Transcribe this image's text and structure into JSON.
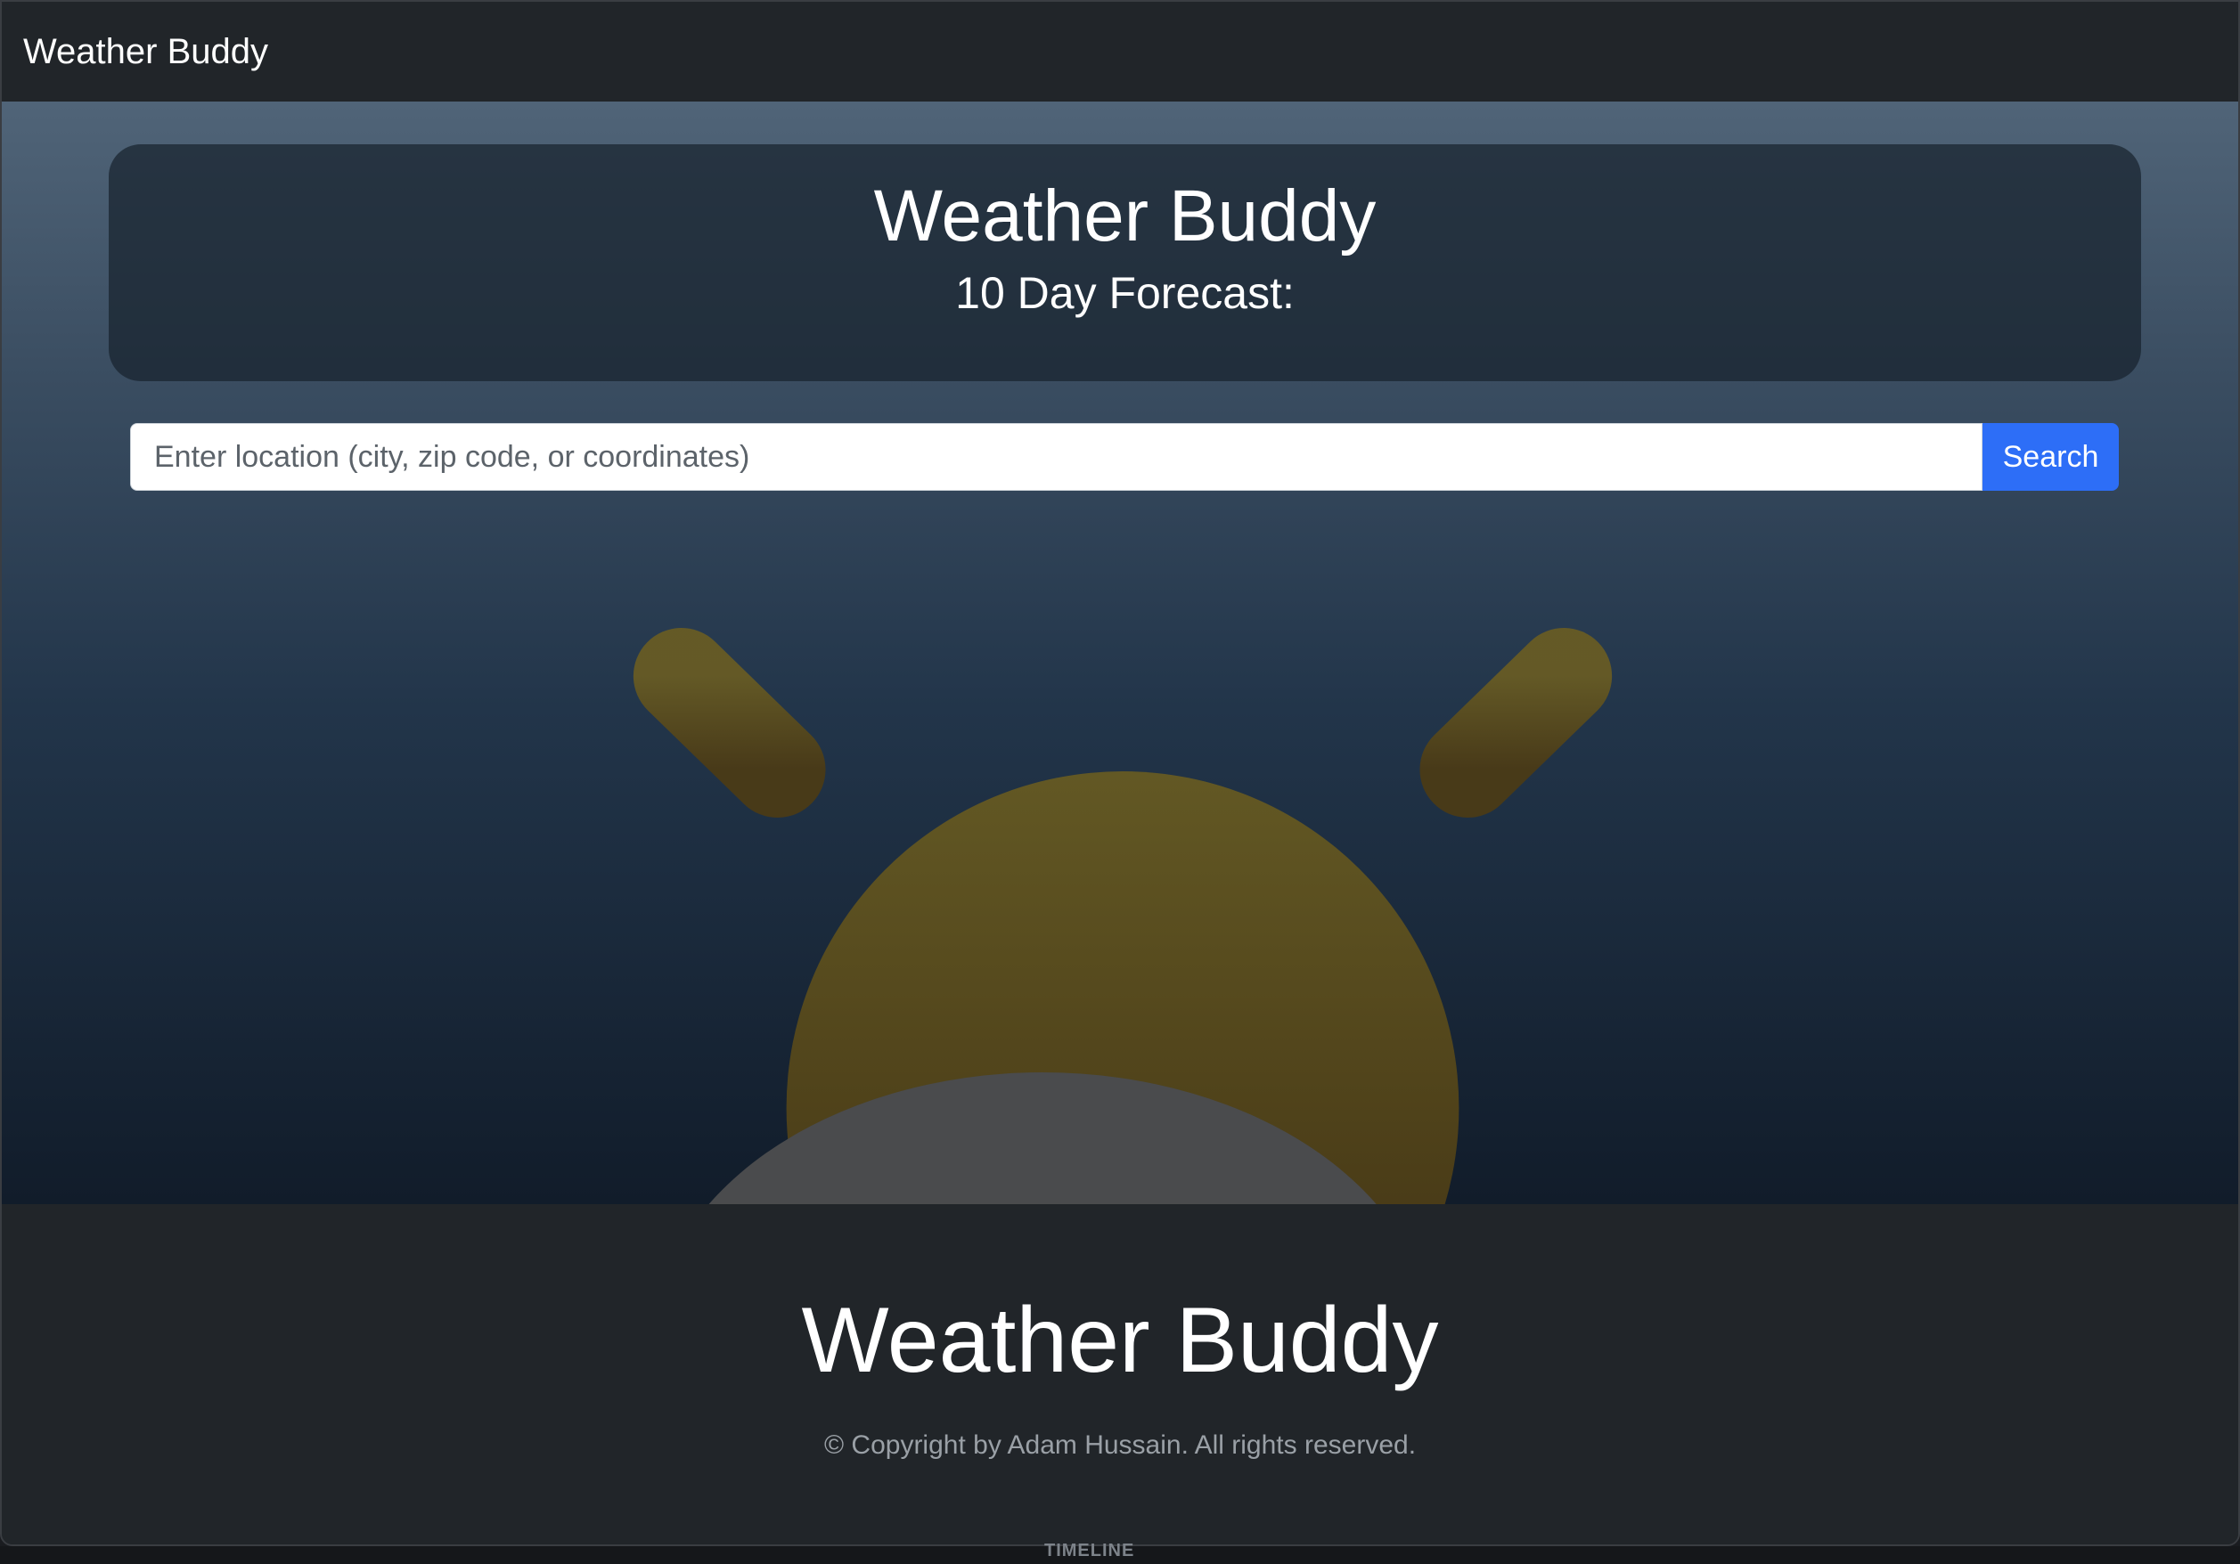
{
  "navbar": {
    "brand": "Weather Buddy"
  },
  "header": {
    "title": "Weather Buddy",
    "subtitle": "10 Day Forecast:"
  },
  "search": {
    "placeholder": "Enter location (city, zip code, or coordinates)",
    "value": "",
    "button_label": "Search"
  },
  "background": {
    "icon": "partly-sunny-weather-icon"
  },
  "footer": {
    "title": "Weather Buddy",
    "copyright": "© Copyright by Adam Hussain. All rights reserved."
  },
  "desktop": {
    "timeline_label": "TIMELINE"
  },
  "colors": {
    "accent": "#2d6ef7",
    "navbar": "#212529",
    "sun": "#6a5a1e"
  }
}
